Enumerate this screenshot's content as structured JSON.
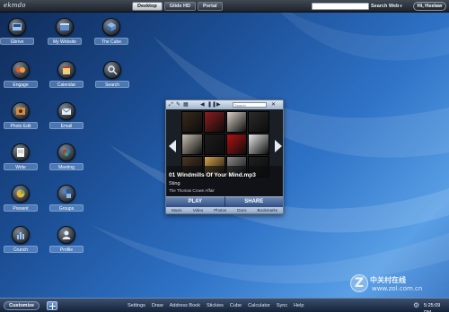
{
  "topbar": {
    "logo": "ekmdo",
    "tabs": [
      {
        "label": "Desktop",
        "active": true
      },
      {
        "label": "Glide HD",
        "active": false
      },
      {
        "label": "Portal",
        "active": false
      }
    ],
    "search_value": "",
    "search_web_label": "Search Web",
    "search_web_chevron": "▾",
    "user_label": "Hi, Hselaw"
  },
  "desktop_icons": [
    {
      "label": "Gbrive",
      "icon": "drive-icon"
    },
    {
      "label": "My Website",
      "icon": "website-icon"
    },
    {
      "label": "The Cube",
      "icon": "cube-icon"
    },
    {
      "label": "Engage",
      "icon": "engage-icon"
    },
    {
      "label": "Calendar",
      "icon": "calendar-icon"
    },
    {
      "label": "Search",
      "icon": "search-icon"
    },
    {
      "label": "Photo Edit",
      "icon": "photo-edit-icon"
    },
    {
      "label": "Email",
      "icon": "email-icon"
    },
    {
      "label": "Write",
      "icon": "write-icon"
    },
    {
      "label": "Meeting",
      "icon": "meeting-icon"
    },
    {
      "label": "Present",
      "icon": "present-icon"
    },
    {
      "label": "Groups",
      "icon": "groups-icon"
    },
    {
      "label": "Crunch",
      "icon": "crunch-icon"
    },
    {
      "label": "Profile",
      "icon": "profile-icon"
    }
  ],
  "media_player": {
    "search_placeholder": "Search",
    "track": "01 Windmills Of Your Mind.mp3",
    "artist": "Sting",
    "album": "The Thomas Crown Affair",
    "play_label": "PLAY",
    "share_label": "SHARE",
    "tabs": [
      "Music",
      "Video",
      "Photos",
      "Docs",
      "Bookmarks"
    ],
    "cover_colors": [
      "#3a2a1c",
      "#8c1d1d",
      "#d9d0c4",
      "#2b2b2b",
      "#c8c0b0",
      "#1c1c1c",
      "#b31212",
      "#e8e8e8",
      "#4a3624",
      "#d4a24c",
      "#8a8a8a",
      "#1f1f1f"
    ]
  },
  "bottombar": {
    "customize_label": "Customize",
    "apps": [
      "Settings",
      "Draw",
      "Address Book",
      "Stickies",
      "Cube",
      "Calculator",
      "Sync",
      "Help"
    ],
    "clock": "5:25:09 PM"
  },
  "watermark": {
    "letter": "Z",
    "chinese": "中关村在线",
    "url": "www.zol.com.cn"
  },
  "colors": {
    "wallpaper_dark": "#0f2a57",
    "wallpaper_light": "#5aa0e6",
    "label_bg": "#78a0d7",
    "player_button": "#2e4e85"
  }
}
